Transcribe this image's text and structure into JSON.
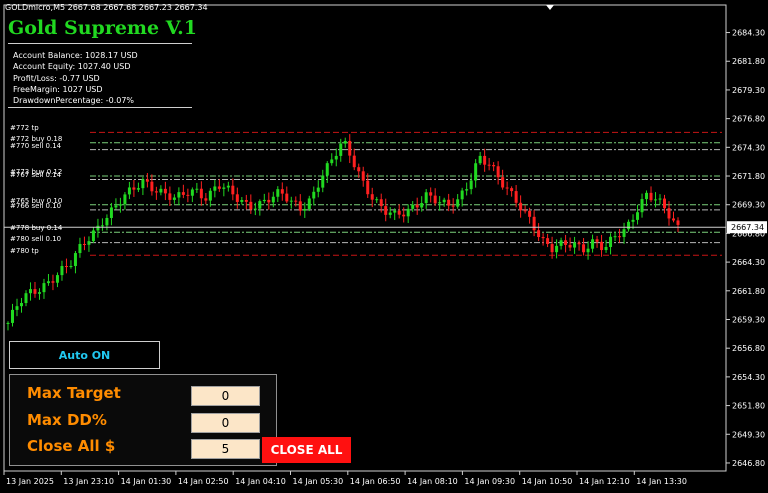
{
  "chart_header": {
    "symbol_line": "GOLDmicro,M5  2667.68 2667.68 2667.23 2667.34"
  },
  "ea": {
    "title": "Gold Supreme V.1"
  },
  "account": {
    "balance": "Account Balance: 1028.17 USD",
    "equity": "Account Equity: 1027.40 USD",
    "profit_loss": "Profit/Loss: -0.77 USD",
    "free_margin": "FreeMargin: 1027 USD",
    "drawdown": "DrawdownPercentage: -0.07%"
  },
  "auto_button": {
    "label": "Auto ON"
  },
  "panel": {
    "max_target_label": "Max Target",
    "max_target_value": "0",
    "max_dd_label": "Max DD%",
    "max_dd_value": "0",
    "close_all_label": "Close All $",
    "close_all_value": "5",
    "close_all_button": "CLOSE ALL"
  },
  "order_labels": [
    {
      "text": "#772 tp",
      "price": 2675.6,
      "color": "#ff2020"
    },
    {
      "text": "#772 buy 0.18",
      "price": 2674.7,
      "color": "#80ff80"
    },
    {
      "text": "#770 sell 0.14",
      "price": 2674.1,
      "color": "#d0d0d0"
    },
    {
      "text": "#773 buy 0.12",
      "price": 2671.8,
      "color": "#80ff80"
    },
    {
      "text": "#767 sell 0.14",
      "price": 2671.5,
      "color": "#d0d0d0"
    },
    {
      "text": "#765 buy 0.10",
      "price": 2669.3,
      "color": "#80ff80"
    },
    {
      "text": "#766 sell 0.10",
      "price": 2668.85,
      "color": "#d0d0d0"
    },
    {
      "text": "#778 buy 0.14",
      "price": 2666.9,
      "color": "#80ff80"
    },
    {
      "text": "#780 sell 0.10",
      "price": 2666.0,
      "color": "#d0d0d0"
    },
    {
      "text": "#780 tp",
      "price": 2664.9,
      "color": "#ff2020"
    }
  ],
  "colors": {
    "bull": "#21d921",
    "bear": "#ff2020",
    "axis": "#cfcfcf",
    "grid": "#2a2a2a"
  },
  "chart_data": {
    "type": "candlestick",
    "ylim": [
      2646.1,
      2686.7
    ],
    "y_ticks": [
      "2684.30",
      "2681.80",
      "2679.30",
      "2676.80",
      "2674.30",
      "2671.80",
      "2669.30",
      "2666.80",
      "2664.30",
      "2661.80",
      "2659.30",
      "2656.80",
      "2654.30",
      "2651.80",
      "2649.30",
      "2646.80"
    ],
    "y_tick_values": [
      2684.3,
      2681.8,
      2679.3,
      2676.8,
      2674.3,
      2671.8,
      2669.3,
      2666.8,
      2664.3,
      2661.8,
      2659.3,
      2656.8,
      2654.3,
      2651.8,
      2649.3,
      2646.8
    ],
    "current_price_label": "2667.34",
    "current_price": 2667.34,
    "x_ticks": [
      "13 Jan 2025",
      "13 Jan 23:10",
      "14 Jan 01:30",
      "14 Jan 02:50",
      "14 Jan 04:10",
      "14 Jan 05:30",
      "14 Jan 06:50",
      "14 Jan 08:10",
      "14 Jan 09:30",
      "14 Jan 10:50",
      "14 Jan 12:10",
      "14 Jan 13:30"
    ],
    "price_path": [
      2659.0,
      2660.6,
      2661.5,
      2662.0,
      2662.8,
      2663.5,
      2664.1,
      2665.6,
      2666.7,
      2668.0,
      2668.9,
      2669.8,
      2670.6,
      2671.4,
      2670.8,
      2670.3,
      2669.7,
      2670.2,
      2670.5,
      2670.0,
      2671.2,
      2670.5,
      2669.6,
      2669.1,
      2669.5,
      2670.0,
      2670.3,
      2669.4,
      2668.9,
      2670.0,
      2672.0,
      2673.2,
      2674.7,
      2673.0,
      2671.2,
      2669.8,
      2668.7,
      2668.2,
      2668.6,
      2669.4,
      2670.3,
      2669.6,
      2669.0,
      2669.6,
      2671.3,
      2673.6,
      2672.8,
      2671.2,
      2670.2,
      2669.2,
      2668.0,
      2666.1,
      2665.3,
      2665.8,
      2666.0,
      2665.6,
      2666.1,
      2665.3,
      2666.5,
      2667.2,
      2668.9,
      2670.2,
      2669.6,
      2668.5,
      2667.3
    ]
  }
}
